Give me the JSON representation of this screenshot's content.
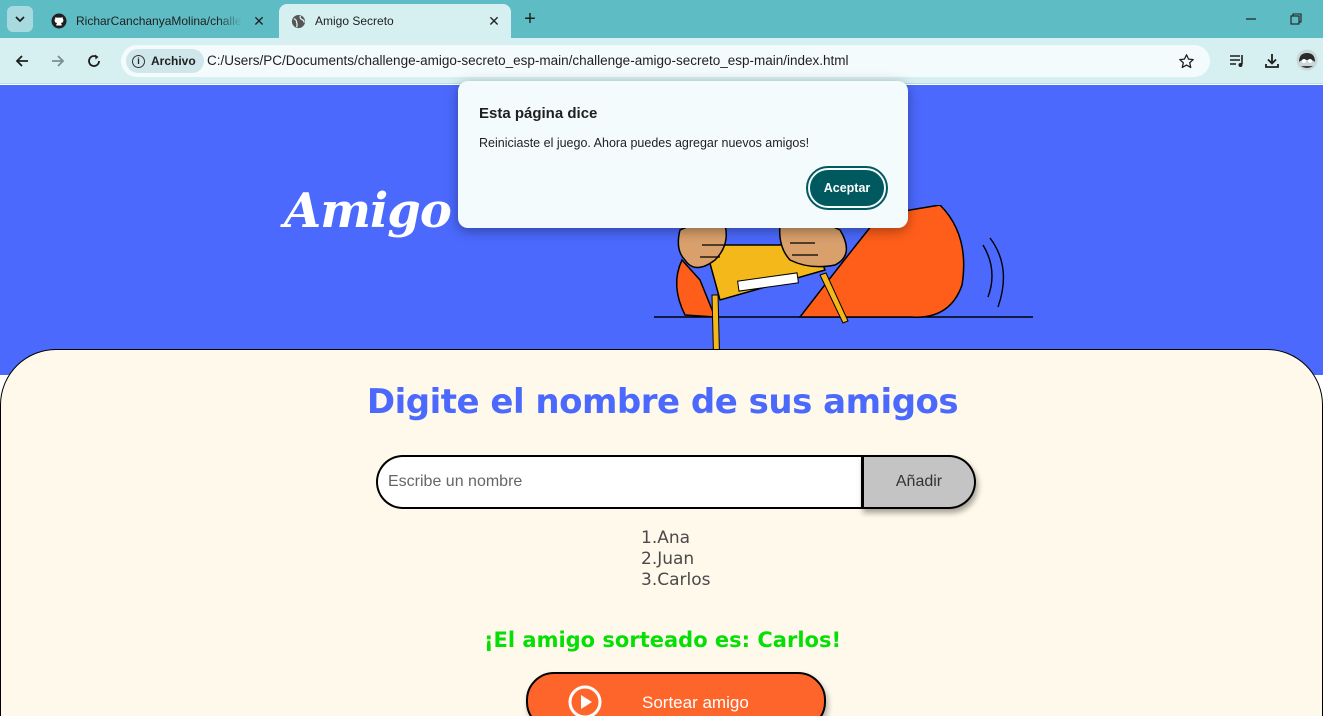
{
  "browser": {
    "tabs": [
      {
        "title": "RicharCanchanyaMolina/challenge-amigo-secreto_esp",
        "icon": "github-icon",
        "active": false
      },
      {
        "title": "Amigo Secreto",
        "icon": "globe-icon",
        "active": true
      }
    ],
    "address": {
      "chip_label": "Archivo",
      "url": "C:/Users/PC/Documents/challenge-amigo-secreto_esp-main/challenge-amigo-secreto_esp-main/index.html"
    },
    "colors": {
      "frame": "#5ebcc4",
      "toolbar": "#d6f0f2"
    }
  },
  "page": {
    "header_title": "Amigo S",
    "section_title": "Digite el nombre de sus amigos",
    "input_placeholder": "Escribe un nombre",
    "input_value": "",
    "add_button": "Añadir",
    "friends": [
      "1.Ana",
      "2.Juan",
      "3.Carlos"
    ],
    "result": "¡El amigo sorteado es: Carlos!",
    "draw_button": "Sortear amigo",
    "colors": {
      "header": "#4b69fd",
      "content": "#fff9eb",
      "result": "#05df05",
      "draw_button": "#fe652b"
    }
  },
  "dialog": {
    "title": "Esta página dice",
    "message": "Reiniciaste el juego. Ahora puedes agregar nuevos amigos!",
    "ok_button": "Aceptar",
    "color": "#00595f"
  }
}
